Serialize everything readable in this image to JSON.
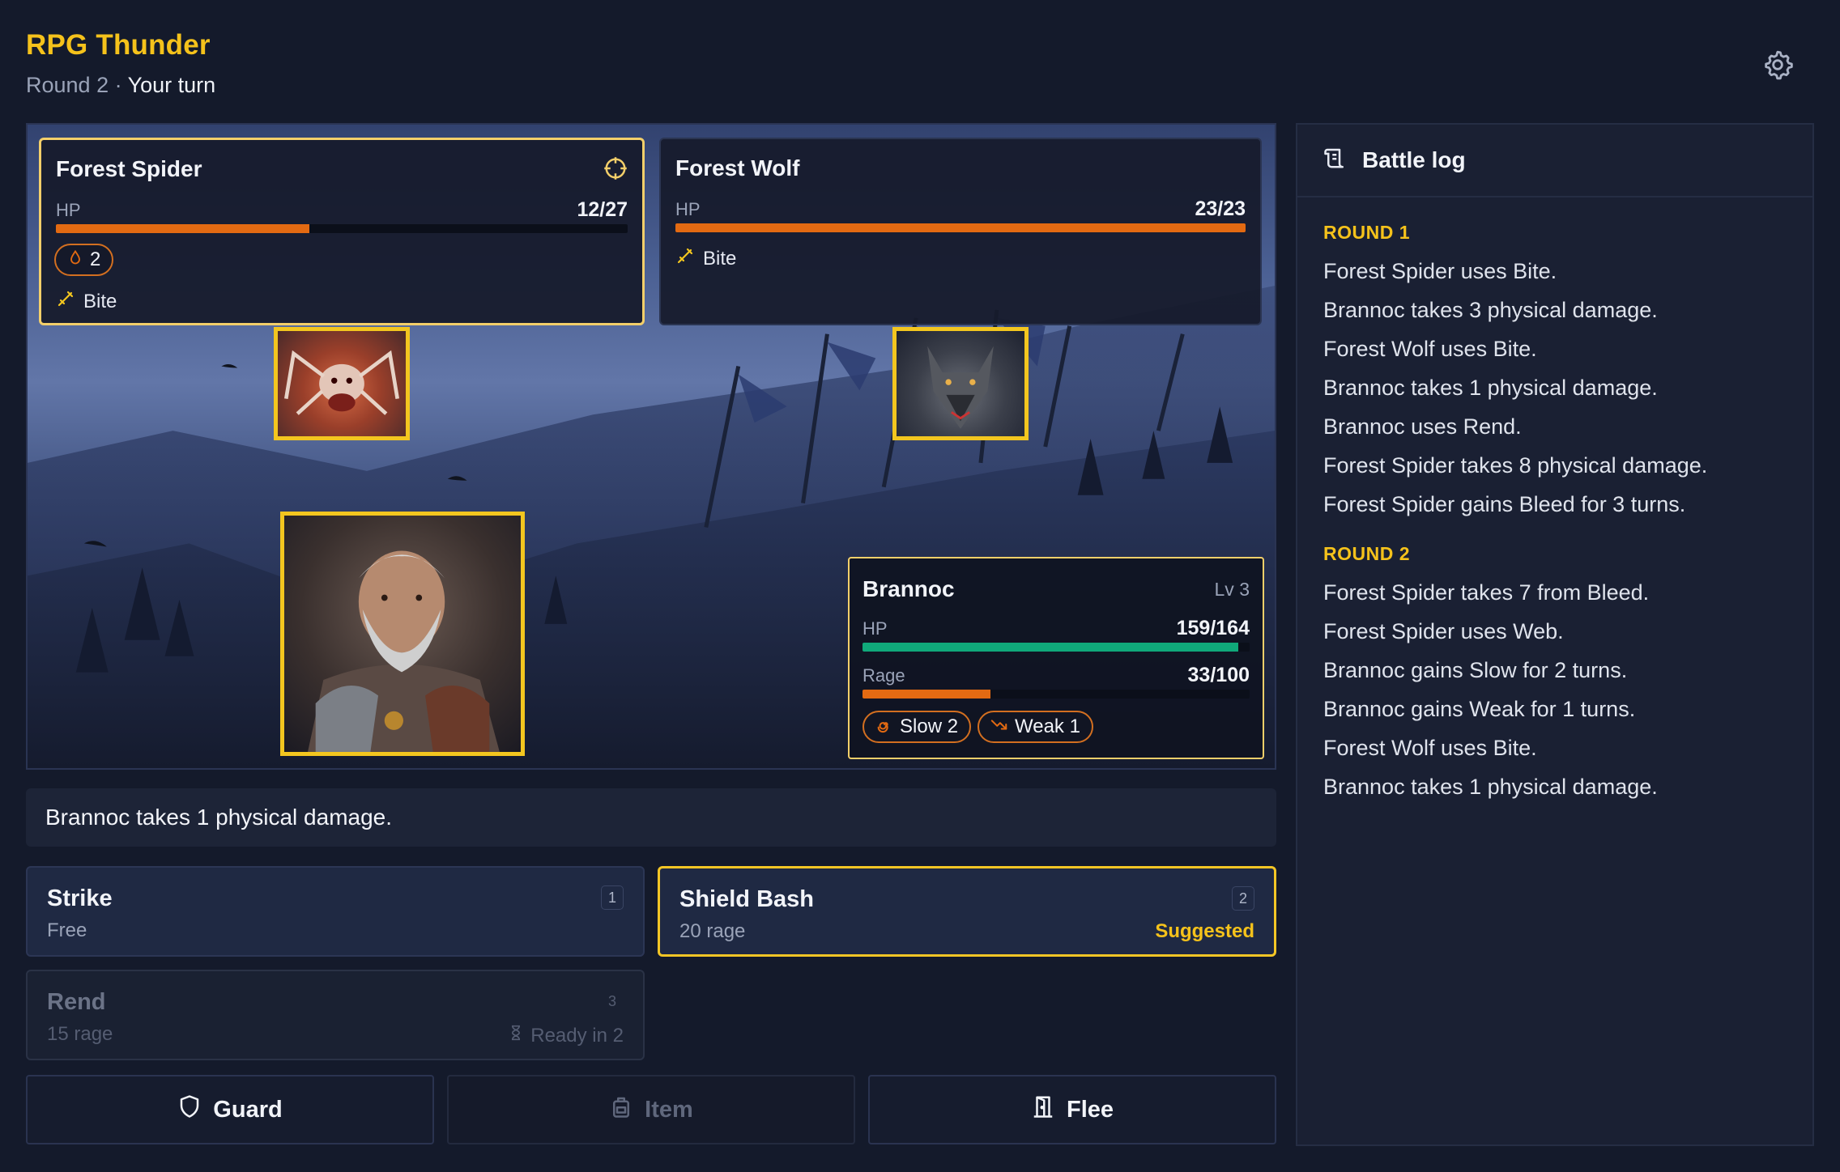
{
  "app": {
    "title": "RPG Thunder",
    "round_label": "Round 2",
    "separator": " · ",
    "turn_label": "Your turn"
  },
  "enemies": [
    {
      "name": "Forest Spider",
      "hp_label": "HP",
      "hp": "12/27",
      "hp_fraction": 0.444,
      "status": [
        {
          "icon": "bleed-drop-icon",
          "value": "2"
        }
      ],
      "move": "Bite",
      "targeted": true
    },
    {
      "name": "Forest Wolf",
      "hp_label": "HP",
      "hp": "23/23",
      "hp_fraction": 1.0,
      "status": [],
      "move": "Bite",
      "targeted": false
    }
  ],
  "hero": {
    "name": "Brannoc",
    "level": "Lv 3",
    "hp_label": "HP",
    "hp": "159/164",
    "hp_fraction": 0.97,
    "rage_label": "Rage",
    "rage": "33/100",
    "rage_fraction": 0.33,
    "statuses": [
      {
        "icon": "slow-spiral-icon",
        "label": "Slow 2"
      },
      {
        "icon": "weak-arrow-icon",
        "label": "Weak 1"
      }
    ]
  },
  "message": "Brannoc takes 1 physical damage.",
  "skills": [
    {
      "name": "Strike",
      "cost": "Free",
      "key": "1"
    },
    {
      "name": "Shield Bash",
      "cost": "20 rage",
      "key": "2",
      "tag": "Suggested"
    },
    {
      "name": "Rend",
      "cost": "15 rage",
      "key": "3",
      "cooldown": "Ready in 2"
    }
  ],
  "actions": [
    {
      "label": "Guard",
      "icon": "shield-icon"
    },
    {
      "label": "Item",
      "icon": "backpack-icon",
      "disabled": true
    },
    {
      "label": "Flee",
      "icon": "door-icon"
    }
  ],
  "log": {
    "title": "Battle log",
    "rounds": [
      {
        "label": "ROUND 1",
        "entries": [
          "Forest Spider uses Bite.",
          "Brannoc takes 3 physical damage.",
          "Forest Wolf uses Bite.",
          "Brannoc takes 1 physical damage.",
          "Brannoc uses Rend.",
          "Forest Spider takes 8 physical damage.",
          "Forest Spider gains Bleed for 3 turns."
        ]
      },
      {
        "label": "ROUND 2",
        "entries": [
          "Forest Spider takes 7 from Bleed.",
          "Forest Spider uses Web.",
          "Brannoc gains Slow for 2 turns.",
          "Brannoc gains Weak for 1 turns.",
          "Forest Wolf uses Bite.",
          "Brannoc takes 1 physical damage."
        ]
      }
    ]
  },
  "colors": {
    "accent": "#f5c21b",
    "hp_enemy": "#e36a12",
    "hp_hero": "#10a97a",
    "background": "#141a2b"
  }
}
